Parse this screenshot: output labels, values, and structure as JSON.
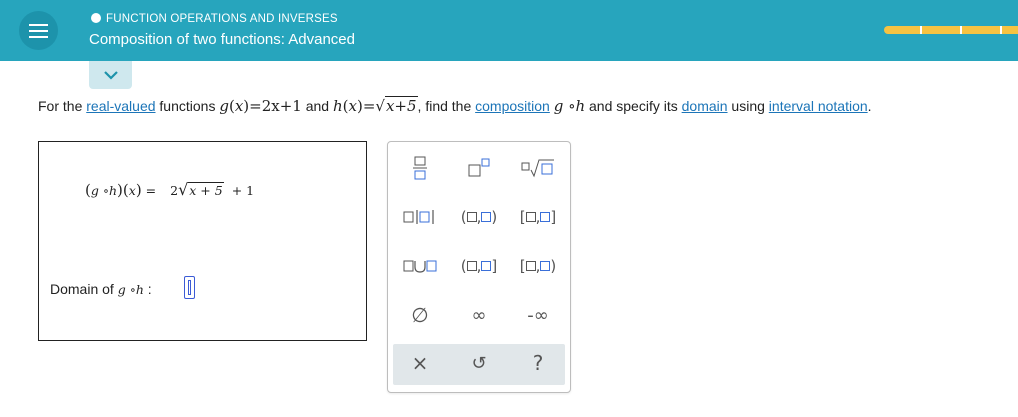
{
  "header": {
    "topic": "FUNCTION OPERATIONS AND INVERSES",
    "title": "Composition of two functions: Advanced",
    "accent_color": "#27a5bd",
    "progress_color": "#f6c342"
  },
  "question": {
    "prefix": "For the ",
    "link_real_valued": "real-valued",
    "functions": " functions ",
    "and": " and ",
    "find_the": ", find the ",
    "link_composition": "composition",
    "and_specify": " and specify its ",
    "link_domain": "domain",
    "using": " using ",
    "link_interval_notation": "interval notation",
    "period": ".",
    "g_def_lhs": "g",
    "g_def_var": "x",
    "g_def_rhs": "=2x+1",
    "h_def_lhs": "h",
    "h_def_var": "x",
    "h_def_eq": "=",
    "h_def_radicand": "x+5"
  },
  "answer": {
    "composition_lhs_g": "g",
    "composition_lhs_circ": " ∘",
    "composition_lhs_h": "h",
    "composition_lhs_x": "x",
    "equals": " = ",
    "coef": "2",
    "radicand": "x + 5",
    "plus_one": "+ 1",
    "domain_label": "Domain of ",
    "domain_g": "g",
    "domain_circ": " ∘",
    "domain_h": "h",
    "domain_colon": " :",
    "domain_value": ""
  },
  "keypad": {
    "infinity": "∞",
    "neg_infinity": "-∞",
    "empty_set": "∅",
    "clear": "×",
    "undo": "↺",
    "help": "?"
  }
}
